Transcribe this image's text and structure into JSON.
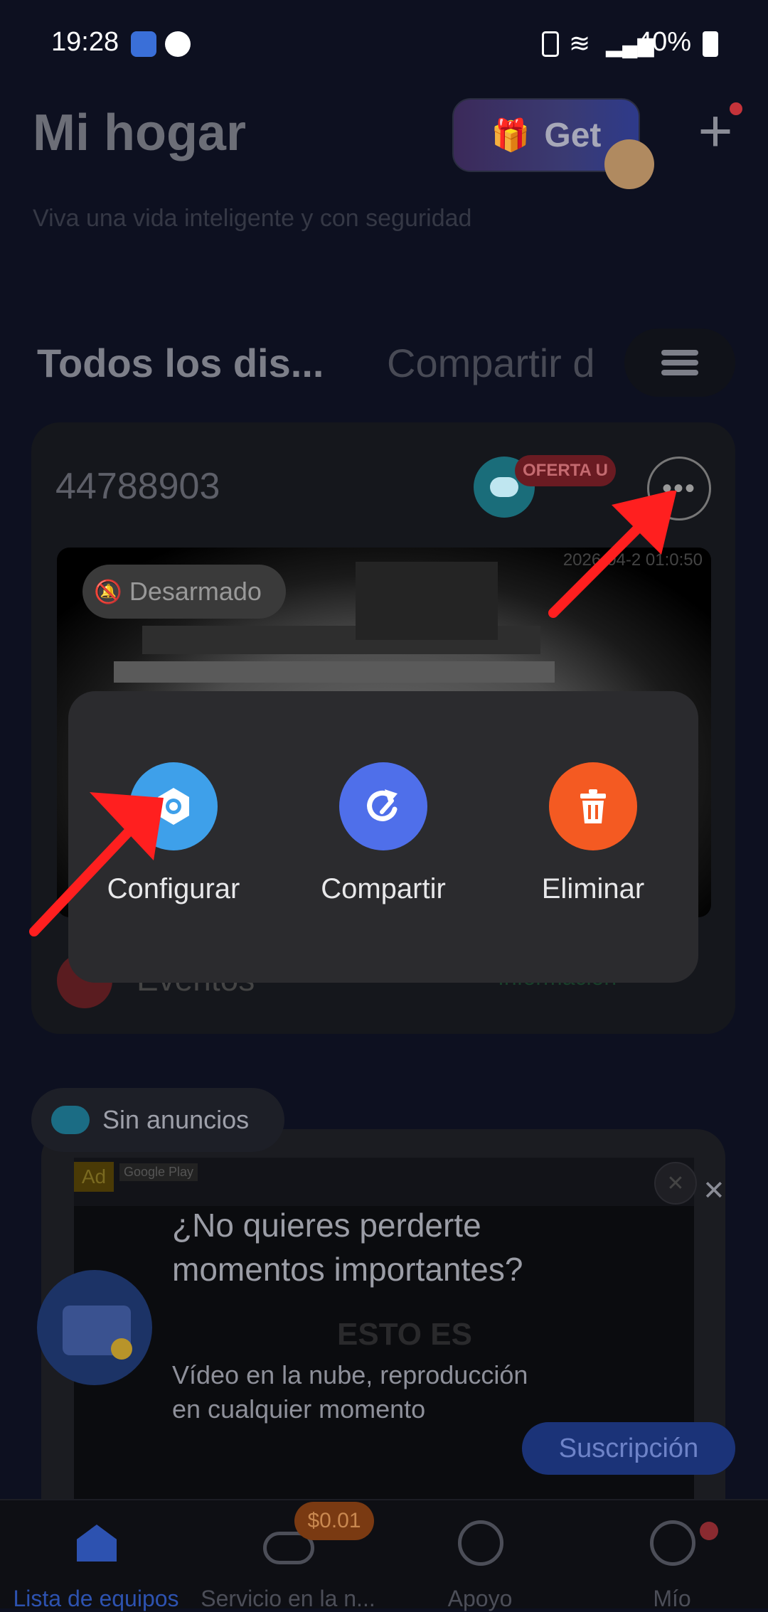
{
  "status_bar": {
    "time": "19:28",
    "battery": "40%"
  },
  "header": {
    "title": "Mi hogar",
    "subtitle": "Viva una vida inteligente y con seguridad",
    "get_label": "Get"
  },
  "tabs": [
    {
      "label": "Todos los dis..."
    },
    {
      "label": "Compartir d"
    }
  ],
  "device": {
    "id": "44788903",
    "offer_badge": "OFERTA U",
    "camera_timestamp": "2026-04-2 01:0:50",
    "status_chip": "Desarmado",
    "events_label": "Eventos",
    "events_info": "Información"
  },
  "popup_actions": [
    {
      "label": "Configurar",
      "color": "#3ea0ea",
      "icon": "gear-icon"
    },
    {
      "label": "Compartir",
      "color": "#4f6fea",
      "icon": "share-icon"
    },
    {
      "label": "Eliminar",
      "color": "#f45a22",
      "icon": "trash-icon"
    }
  ],
  "noads": {
    "label": "Sin anuncios"
  },
  "ad": {
    "tag": "Ad",
    "store": "Google Play",
    "headline": "¿No quieres perderte momentos importantes?",
    "body": "Vídeo en la nube, reproducción en cualquier momento",
    "watermark": "ESTO ES",
    "cta": "Suscripción"
  },
  "bottom_nav": [
    {
      "label": "Lista de equipos",
      "icon": "home-icon"
    },
    {
      "label": "Servicio en la n...",
      "icon": "cloud-icon",
      "badge": "$0.01"
    },
    {
      "label": "Apoyo",
      "icon": "compass-icon"
    },
    {
      "label": "Mío",
      "icon": "smiley-icon"
    }
  ],
  "colors": {
    "accent": "#2d52b0",
    "arrow": "#ff1f1f"
  }
}
